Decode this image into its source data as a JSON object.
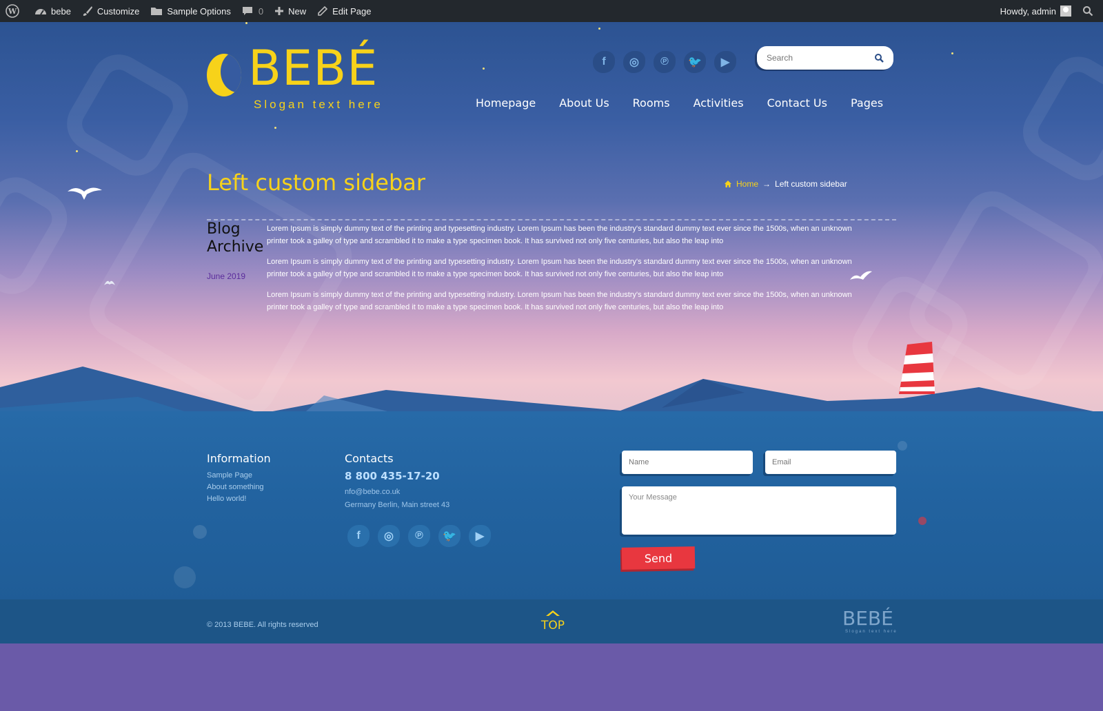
{
  "admin_bar": {
    "site_name": "bebe",
    "customize": "Customize",
    "sample_options": "Sample Options",
    "comments_count": "0",
    "new": "New",
    "edit_page": "Edit Page",
    "howdy": "Howdy, admin"
  },
  "header": {
    "logo_text": "BEBÉ",
    "slogan": "Slogan text here",
    "search_placeholder": "Search",
    "social": [
      "f",
      "◎",
      "℗",
      "🐦",
      "▶"
    ],
    "nav": [
      "Homepage",
      "About Us",
      "Rooms",
      "Activities",
      "Contact Us",
      "Pages"
    ]
  },
  "page": {
    "title": "Left custom sidebar",
    "breadcrumb": {
      "home": "Home",
      "separator": "→",
      "current": "Left custom sidebar"
    }
  },
  "sidebar": {
    "title": "Blog Archive",
    "links": [
      "June 2019"
    ]
  },
  "content": {
    "paragraphs": [
      "Lorem Ipsum is simply dummy text of the printing and typesetting industry. Lorem Ipsum has been the industry's standard dummy text ever since the 1500s, when an unknown printer took a galley of type and scrambled it to make a type specimen book. It has survived not only five centuries, but also the leap into",
      "Lorem Ipsum is simply dummy text of the printing and typesetting industry. Lorem Ipsum has been the industry's standard dummy text ever since the 1500s, when an unknown printer took a galley of type and scrambled it to make a type specimen book. It has survived not only five centuries, but also the leap into",
      "Lorem Ipsum is simply dummy text of the printing and typesetting industry. Lorem Ipsum has been the industry's standard dummy text ever since the 1500s, when an unknown printer took a galley of type and scrambled it to make a type specimen book. It has survived not only five centuries, but also the leap into"
    ]
  },
  "footer": {
    "information": {
      "title": "Information",
      "links": [
        "Sample Page",
        "About something",
        "Hello world!"
      ]
    },
    "contacts": {
      "title": "Contacts",
      "phone": "8 800 435-17-20",
      "email": "nfo@bebe.co.uk",
      "address": "Germany Berlin, Main street 43"
    },
    "form": {
      "name_placeholder": "Name",
      "email_placeholder": "Email",
      "message_placeholder": "Your Message",
      "send": "Send"
    },
    "copyright": "© 2013 BEBE. All rights reserved",
    "top": "TOP",
    "logo_text": "BEBÉ",
    "logo_sub": "Slogan text here"
  },
  "colors": {
    "accent_yellow": "#f7d21a",
    "admin_bar": "#23282d",
    "send_button": "#e8373f",
    "page_bottom": "#6a5aa8"
  }
}
